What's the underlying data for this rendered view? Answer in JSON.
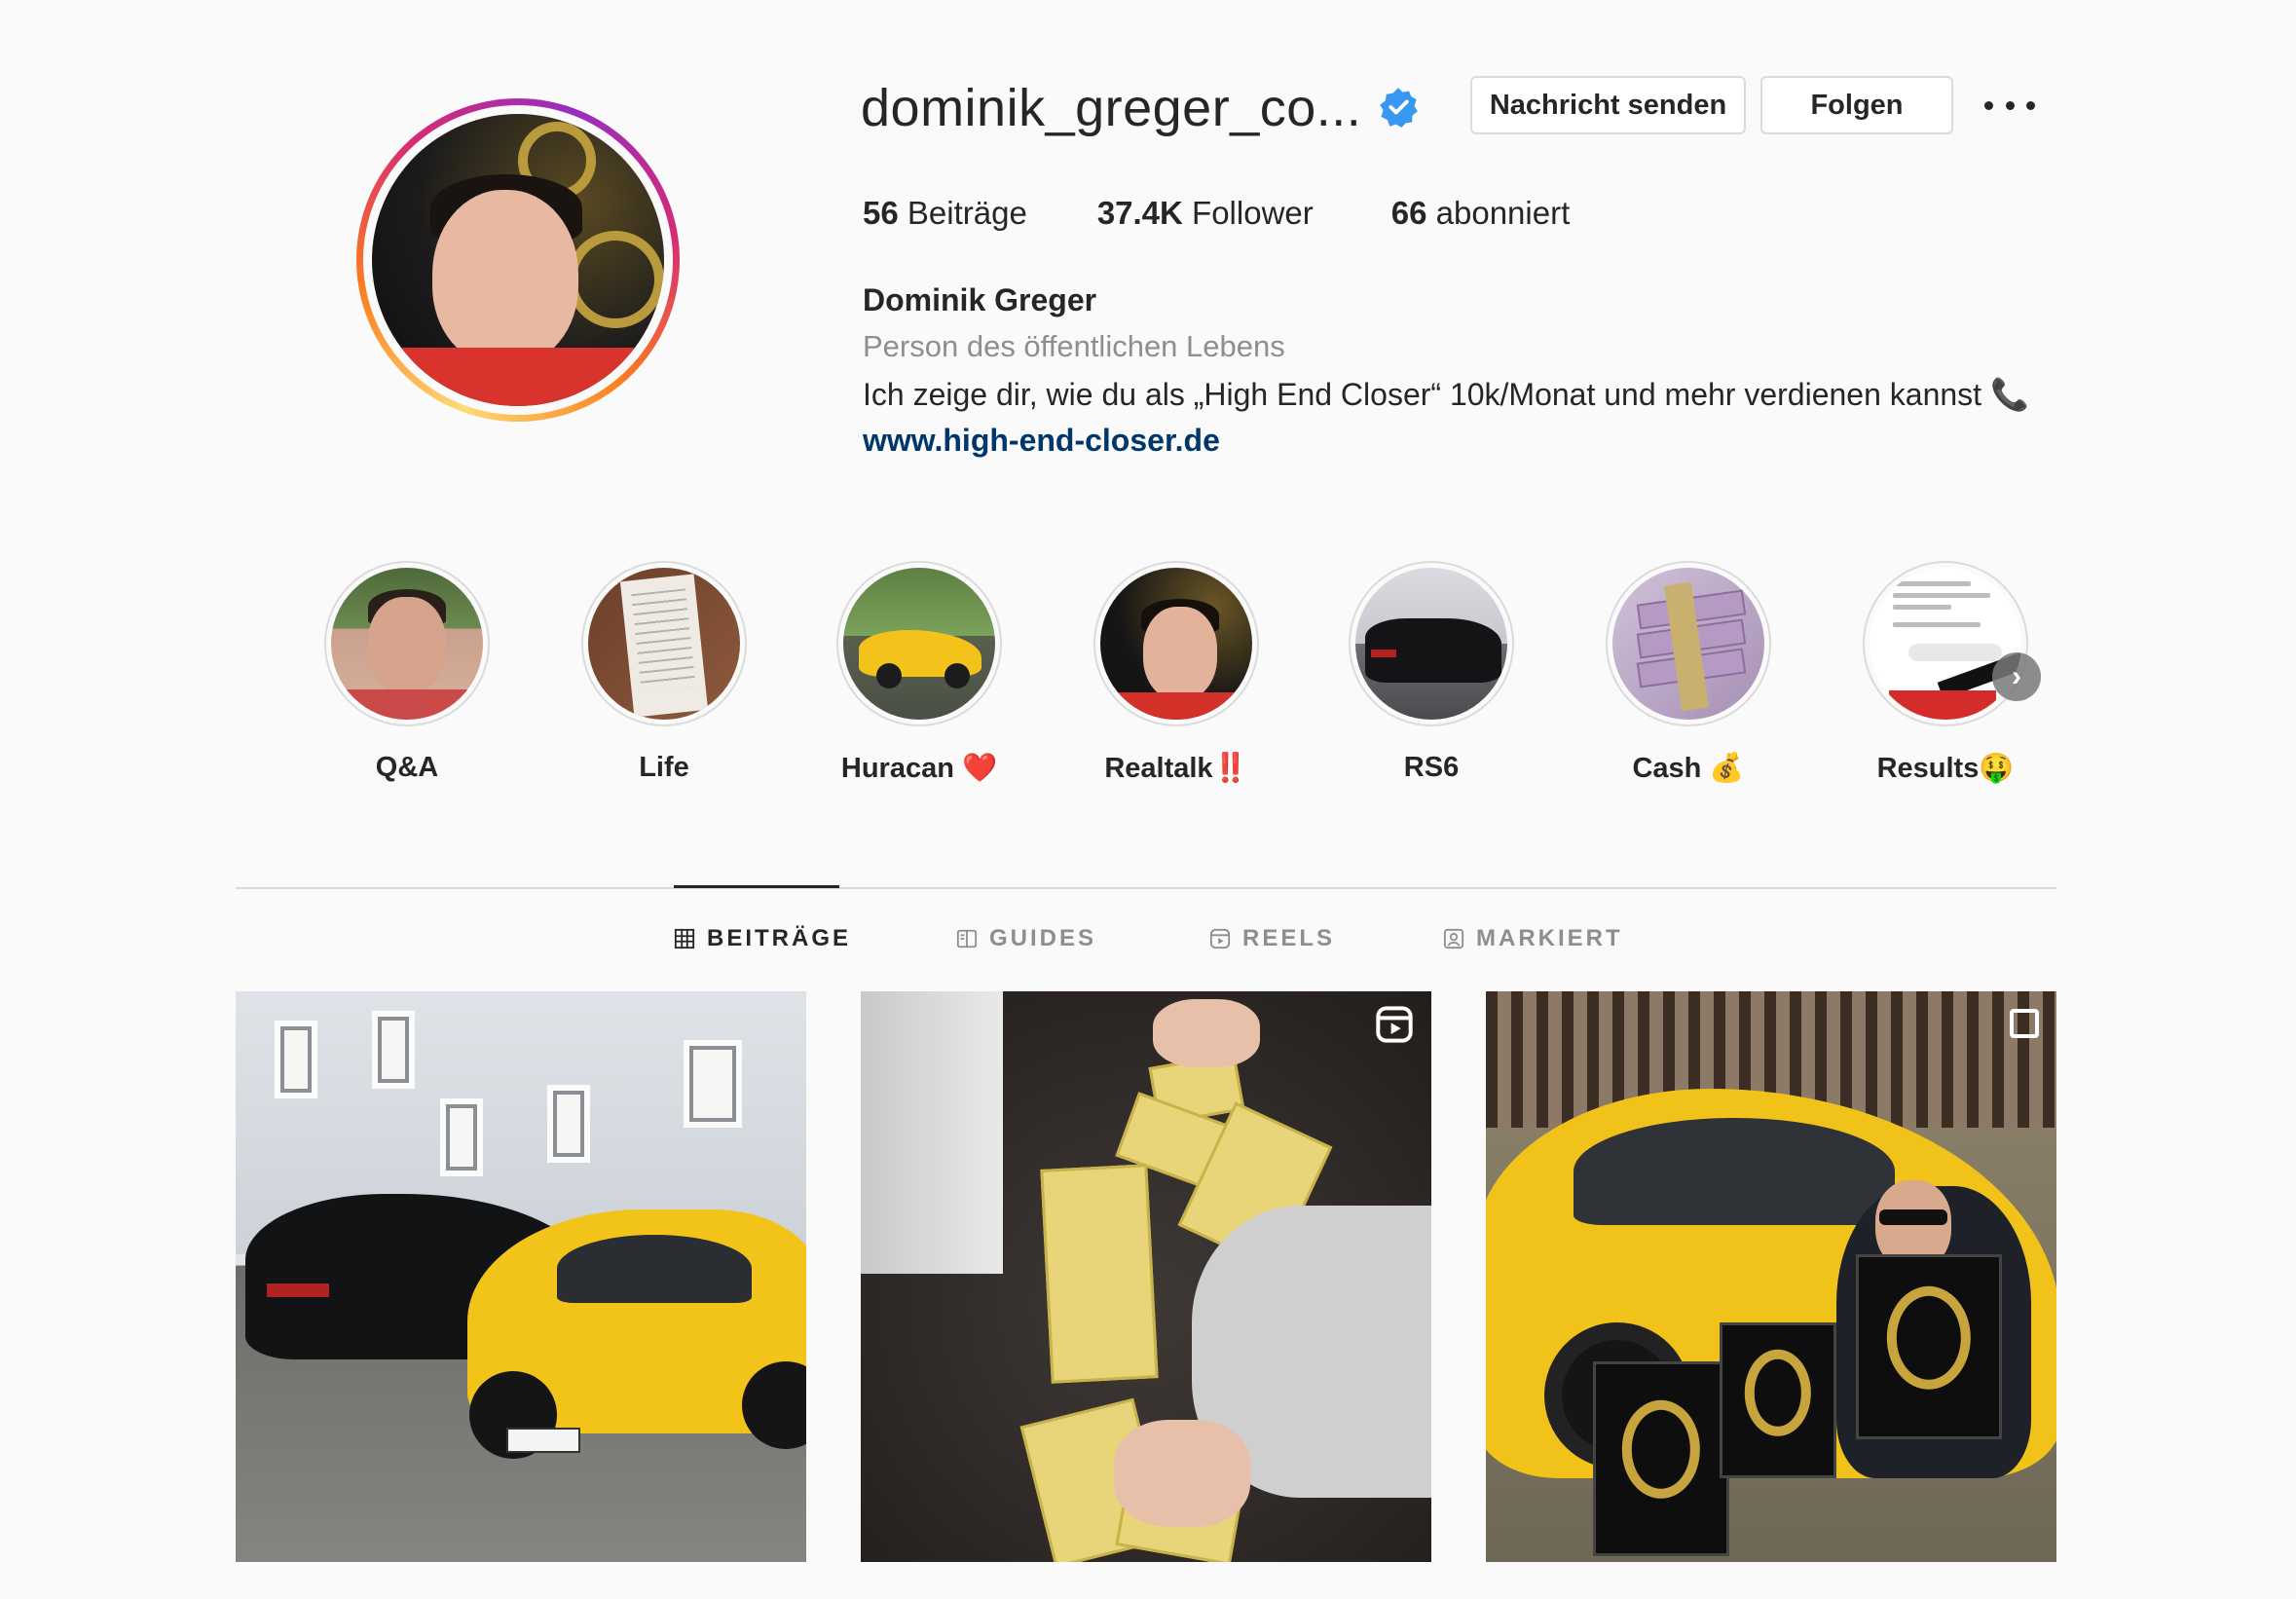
{
  "profile": {
    "username": "dominik_greger_co...",
    "verified": true,
    "message_button": "Nachricht senden",
    "follow_button": "Folgen",
    "stats": {
      "posts_count": "56",
      "posts_label": "Beiträge",
      "followers_count": "37.4K",
      "followers_label": "Follower",
      "following_count": "66",
      "following_label": "abonniert"
    },
    "full_name": "Dominik Greger",
    "category": "Person des öffentlichen Lebens",
    "bio": "Ich zeige dir, wie du als „High End Closer“ 10k/Monat und mehr verdienen kannst",
    "bio_emoji": "📞",
    "website": "www.high-end-closer.de"
  },
  "highlights": [
    {
      "label": "Q&A"
    },
    {
      "label": "Life"
    },
    {
      "label": "Huracan ❤️"
    },
    {
      "label": "Realtalk‼️"
    },
    {
      "label": "RS6"
    },
    {
      "label": "Cash 💰"
    },
    {
      "label": "Results🤑"
    }
  ],
  "tabs": [
    {
      "label": "BEITRÄGE",
      "icon": "grid-icon",
      "active": true
    },
    {
      "label": "GUIDES",
      "icon": "guides-icon",
      "active": false
    },
    {
      "label": "REELS",
      "icon": "reels-icon",
      "active": false
    },
    {
      "label": "MARKIERT",
      "icon": "tagged-icon",
      "active": false
    }
  ],
  "posts": [
    {
      "type": "photo"
    },
    {
      "type": "reel"
    },
    {
      "type": "carousel"
    }
  ],
  "colors": {
    "background": "#fafafa",
    "text": "#262626",
    "secondary_text": "#8e8e8e",
    "link": "#00376b",
    "verified_blue": "#3897f0",
    "border": "#dbdbdb"
  }
}
